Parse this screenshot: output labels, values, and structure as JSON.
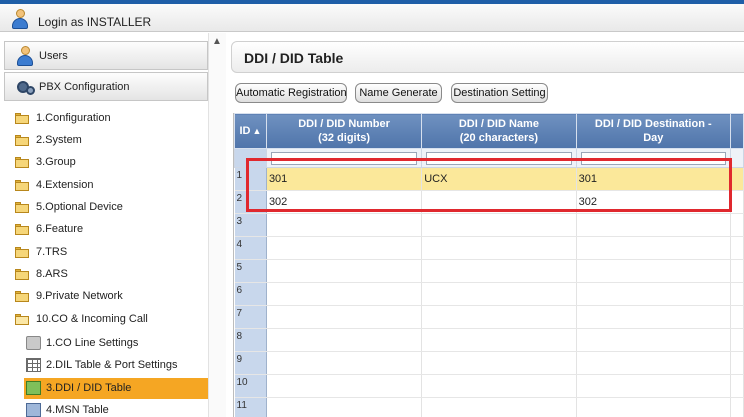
{
  "header": {
    "login_text": "Login as INSTALLER"
  },
  "sidebar": {
    "sections": [
      {
        "label": "Users",
        "icon": "user-icon"
      },
      {
        "label": "PBX Configuration",
        "icon": "gears-icon"
      }
    ],
    "items": [
      {
        "label": "1.Configuration",
        "icon": "folder-icon"
      },
      {
        "label": "2.System",
        "icon": "folder-icon"
      },
      {
        "label": "3.Group",
        "icon": "folder-icon"
      },
      {
        "label": "4.Extension",
        "icon": "folder-icon"
      },
      {
        "label": "5.Optional Device",
        "icon": "folder-icon"
      },
      {
        "label": "6.Feature",
        "icon": "folder-icon"
      },
      {
        "label": "7.TRS",
        "icon": "folder-icon"
      },
      {
        "label": "8.ARS",
        "icon": "folder-icon"
      },
      {
        "label": "9.Private Network",
        "icon": "folder-icon"
      },
      {
        "label": "10.CO & Incoming Call",
        "icon": "folder-open-icon"
      }
    ],
    "sub_items": [
      {
        "label": "1.CO Line Settings",
        "icon": "co-line-icon"
      },
      {
        "label": "2.DIL Table & Port Settings",
        "icon": "table-icon"
      },
      {
        "label": "3.DDI / DID Table",
        "icon": "ddi-icon",
        "selected": true
      },
      {
        "label": "4.MSN Table",
        "icon": "msn-icon"
      }
    ]
  },
  "main": {
    "title": "DDI / DID Table",
    "buttons": {
      "auto_reg": "Automatic Registration",
      "name_gen": "Name Generate",
      "dest_setting": "Destination Setting"
    },
    "table": {
      "columns": [
        {
          "line1": "ID",
          "line2": ""
        },
        {
          "line1": "DDI / DID Number",
          "line2": "(32 digits)"
        },
        {
          "line1": "DDI / DID Name",
          "line2": "(20 characters)"
        },
        {
          "line1": "DDI / DID Destination -",
          "line2": "Day"
        }
      ],
      "rows": [
        {
          "id": "1",
          "number": "301",
          "name": "UCX",
          "dest": "301"
        },
        {
          "id": "2",
          "number": "302",
          "name": "",
          "dest": "302"
        },
        {
          "id": "3",
          "number": "",
          "name": "",
          "dest": ""
        },
        {
          "id": "4",
          "number": "",
          "name": "",
          "dest": ""
        },
        {
          "id": "5",
          "number": "",
          "name": "",
          "dest": ""
        },
        {
          "id": "6",
          "number": "",
          "name": "",
          "dest": ""
        },
        {
          "id": "7",
          "number": "",
          "name": "",
          "dest": ""
        },
        {
          "id": "8",
          "number": "",
          "name": "",
          "dest": ""
        },
        {
          "id": "9",
          "number": "",
          "name": "",
          "dest": ""
        },
        {
          "id": "10",
          "number": "",
          "name": "",
          "dest": ""
        },
        {
          "id": "11",
          "number": "",
          "name": "",
          "dest": ""
        }
      ]
    }
  },
  "colors": {
    "header_blue": "#5a7fb3",
    "selected_orange": "#f5a623",
    "highlight_yellow": "#fbe89a",
    "annotation_red": "#e0282e"
  }
}
